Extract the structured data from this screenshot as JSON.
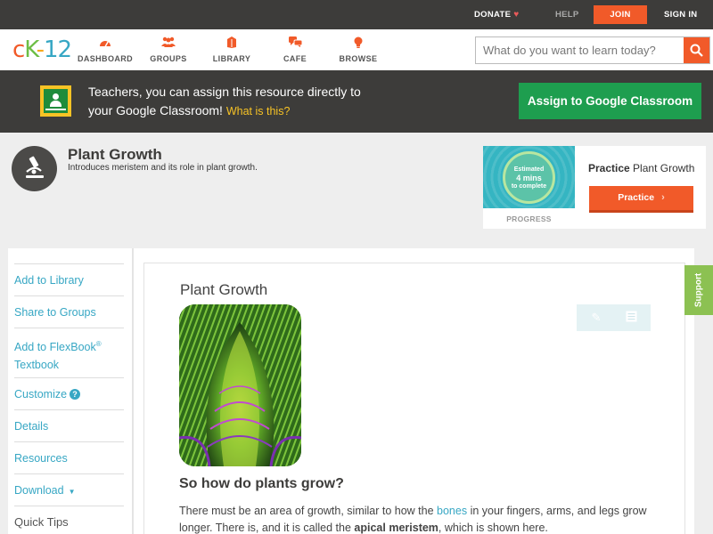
{
  "topbar": {
    "donate": "DONATE",
    "help": "HELP",
    "join": "JOIN",
    "signin": "SIGN IN"
  },
  "logo": {
    "c": "c",
    "k": "K",
    "dash": "-",
    "num": "12"
  },
  "nav": {
    "dashboard": "DASHBOARD",
    "groups": "GROUPS",
    "library": "LIBRARY",
    "cafe": "CAFE",
    "browse": "BROWSE"
  },
  "search": {
    "placeholder": "What do you want to learn today?"
  },
  "classroom_banner": {
    "line1": "Teachers, you can assign this resource directly to",
    "line2": "your Google Classroom!",
    "what_link": "What is this?",
    "assign_button": "Assign to Google Classroom"
  },
  "concept": {
    "title": "Plant Growth",
    "description": "Introduces meristem and its role in plant growth."
  },
  "practice_card": {
    "badge_line1": "Estimated",
    "badge_line2": "4 mins",
    "badge_line3": "to complete",
    "progress_label": "PROGRESS",
    "title_bold": "Practice",
    "title_rest": "Plant Growth",
    "button": "Practice"
  },
  "sidebar": {
    "add_library": "Add to Library",
    "share_groups": "Share to Groups",
    "add_flexbook": "Add to FlexBook",
    "flexbook_reg": "®",
    "textbook": "Textbook",
    "customize": "Customize",
    "customize_help": "?",
    "details": "Details",
    "resources": "Resources",
    "download": "Download",
    "quick_tips": "Quick Tips"
  },
  "content": {
    "title": "Plant Growth",
    "subheading": "So how do plants grow?",
    "para_1": "There must be an area of growth, similar to how the ",
    "para_link": "bones",
    "para_2": " in your fingers, arms, and legs grow longer. There is, and it is called the ",
    "para_bold": "apical meristem",
    "para_3": ", which is shown here."
  },
  "support_tab": "Support",
  "colors": {
    "accent_orange": "#f15a29",
    "link_blue": "#37a7c4",
    "classroom_green": "#1e9e4f",
    "dark_bar": "#3d3c3a",
    "support_green": "#8cc152"
  }
}
